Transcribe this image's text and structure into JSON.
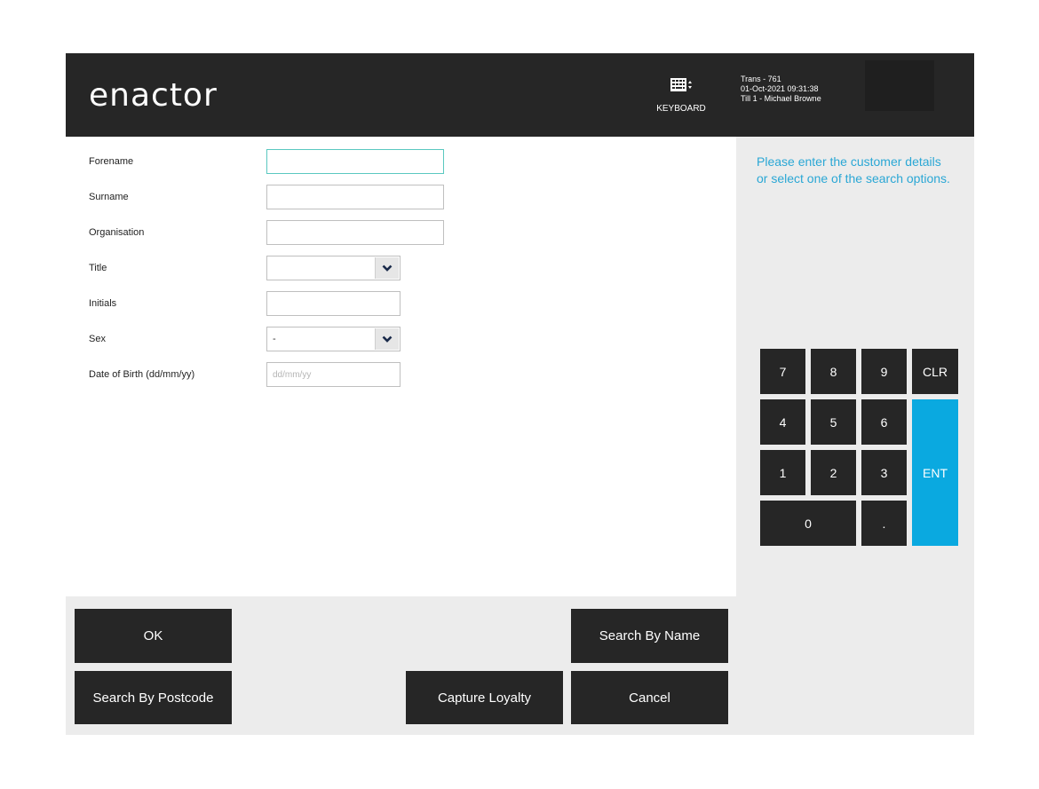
{
  "header": {
    "logo_text": "enactor",
    "keyboard_label": "KEYBOARD",
    "trans": "Trans - 761",
    "datetime": "01-Oct-2021 09:31:38",
    "till": "Till 1 - Michael Browne"
  },
  "form": {
    "forename": {
      "label": "Forename",
      "value": ""
    },
    "surname": {
      "label": "Surname",
      "value": ""
    },
    "organisation": {
      "label": "Organisation",
      "value": ""
    },
    "title": {
      "label": "Title",
      "value": ""
    },
    "initials": {
      "label": "Initials",
      "value": ""
    },
    "sex": {
      "label": "Sex",
      "value": "-"
    },
    "dob": {
      "label": "Date of Birth (dd/mm/yy)",
      "placeholder": "dd/mm/yy"
    }
  },
  "message": "Please enter the customer details or select one of the search options.",
  "keypad": {
    "k7": "7",
    "k8": "8",
    "k9": "9",
    "clr": "CLR",
    "k4": "4",
    "k5": "5",
    "k6": "6",
    "k1": "1",
    "k2": "2",
    "k3": "3",
    "ent": "ENT",
    "k0": "0",
    "dot": "."
  },
  "buttons": {
    "ok": "OK",
    "search_by_name": "Search By Name",
    "search_by_postcode": "Search By Postcode",
    "capture_loyalty": "Capture Loyalty",
    "cancel": "Cancel"
  },
  "colors": {
    "header_bg": "#262626",
    "accent": "#2aa7d5",
    "ent_key": "#0aa9e0"
  }
}
